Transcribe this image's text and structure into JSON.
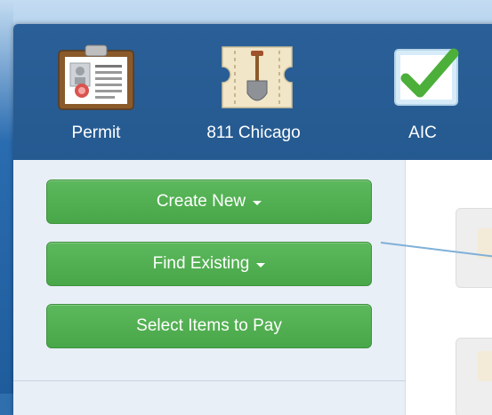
{
  "nav": {
    "items": [
      {
        "label": "Permit",
        "icon": "clipboard-permit-icon"
      },
      {
        "label": "811 Chicago",
        "icon": "shovel-ticket-icon"
      },
      {
        "label": "AIC",
        "icon": "green-checkbox-icon"
      }
    ]
  },
  "sidebar": {
    "create_new": "Create New",
    "find_existing": "Find Existing",
    "select_items": "Select Items to Pay"
  },
  "colors": {
    "header": "#255a91",
    "button_green": "#5cb85c",
    "sidebar_bg": "#e9eff7"
  }
}
